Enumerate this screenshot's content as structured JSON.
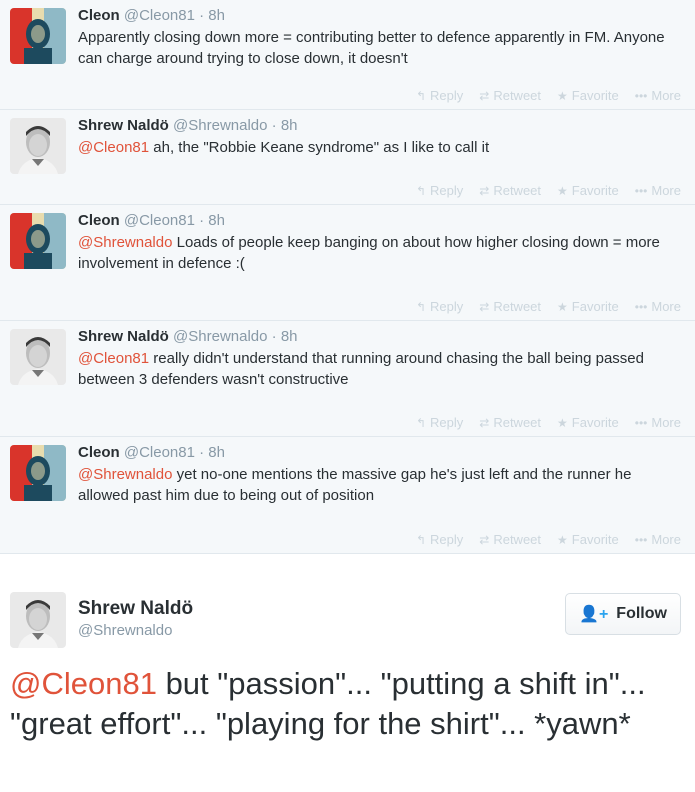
{
  "actions": {
    "reply": "Reply",
    "retweet": "Retweet",
    "favorite": "Favorite",
    "more": "More"
  },
  "tweets": [
    {
      "name": "Cleon",
      "handle": "@Cleon81",
      "time": "8h",
      "mention": "",
      "text": "Apparently closing down more = contributing better to defence apparently in FM. Anyone can charge around trying to close down, it doesn't"
    },
    {
      "name": "Shrew Naldö",
      "handle": "@Shrewnaldo",
      "time": "8h",
      "mention": "@Cleon81",
      "text": " ah, the \"Robbie Keane syndrome\" as I like to call it"
    },
    {
      "name": "Cleon",
      "handle": "@Cleon81",
      "time": "8h",
      "mention": "@Shrewnaldo",
      "text": " Loads of people keep banging on about how higher closing down = more involvement in defence :("
    },
    {
      "name": "Shrew Naldö",
      "handle": "@Shrewnaldo",
      "time": "8h",
      "mention": "@Cleon81",
      "text": " really didn't understand that running around chasing the ball being passed between 3 defenders wasn't constructive"
    },
    {
      "name": "Cleon",
      "handle": "@Cleon81",
      "time": "8h",
      "mention": "@Shrewnaldo",
      "text": " yet no-one mentions the massive gap he's just left and the runner he allowed past him due to being out of position"
    }
  ],
  "focus": {
    "name": "Shrew Naldö",
    "handle": "@Shrewnaldo",
    "follow_label": "Follow",
    "mention": "@Cleon81",
    "text": " but \"passion\"... \"putting a shift in\"... \"great effort\"... \"playing for the shirt\"... *yawn*"
  },
  "colors": {
    "mention": "#e0533a",
    "follow_icon": "#2aa3ef"
  }
}
